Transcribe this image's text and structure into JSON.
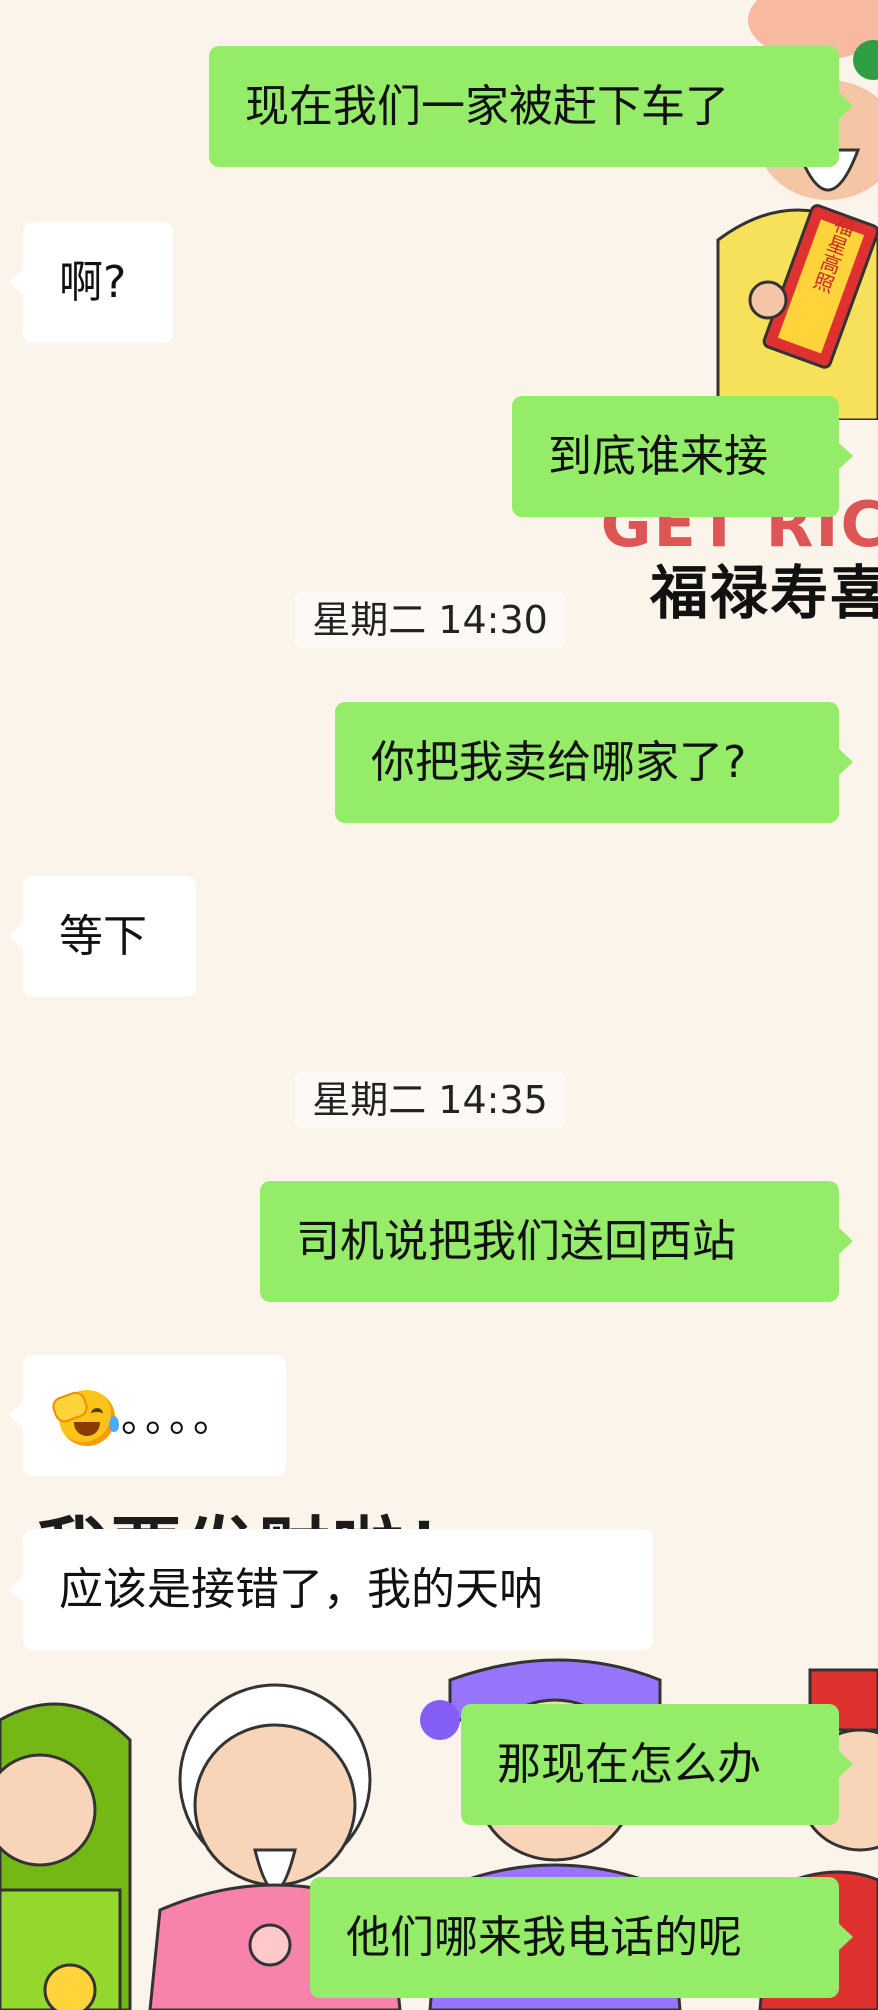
{
  "background": {
    "getrich_text": "GET RIC",
    "blessing_text": "福禄寿喜",
    "big_text": "我要发财啦！",
    "scroll_text": "福星高照",
    "colors": {
      "page": "#fbf4ea",
      "outgoing": "#95ec69",
      "incoming": "#ffffff"
    }
  },
  "messages": [
    {
      "side": "out",
      "text": "现在我们一家被赶下车了"
    },
    {
      "side": "in",
      "text": "啊?"
    },
    {
      "side": "out",
      "text": "到底谁来接"
    },
    {
      "timestamp": "星期二 14:30"
    },
    {
      "side": "out",
      "text": "你把我卖给哪家了?"
    },
    {
      "side": "in",
      "text": "等下"
    },
    {
      "timestamp": "星期二 14:35"
    },
    {
      "side": "out",
      "text": "司机说把我们送回西站"
    },
    {
      "side": "in",
      "emoji": "facepalm-crying-laugh-emoji",
      "text": "。。。。"
    },
    {
      "side": "in",
      "text": "应该是接错了，我的天呐"
    },
    {
      "side": "out",
      "text": "那现在怎么办"
    },
    {
      "side": "out",
      "text": "他们哪来我电话的呢"
    }
  ]
}
